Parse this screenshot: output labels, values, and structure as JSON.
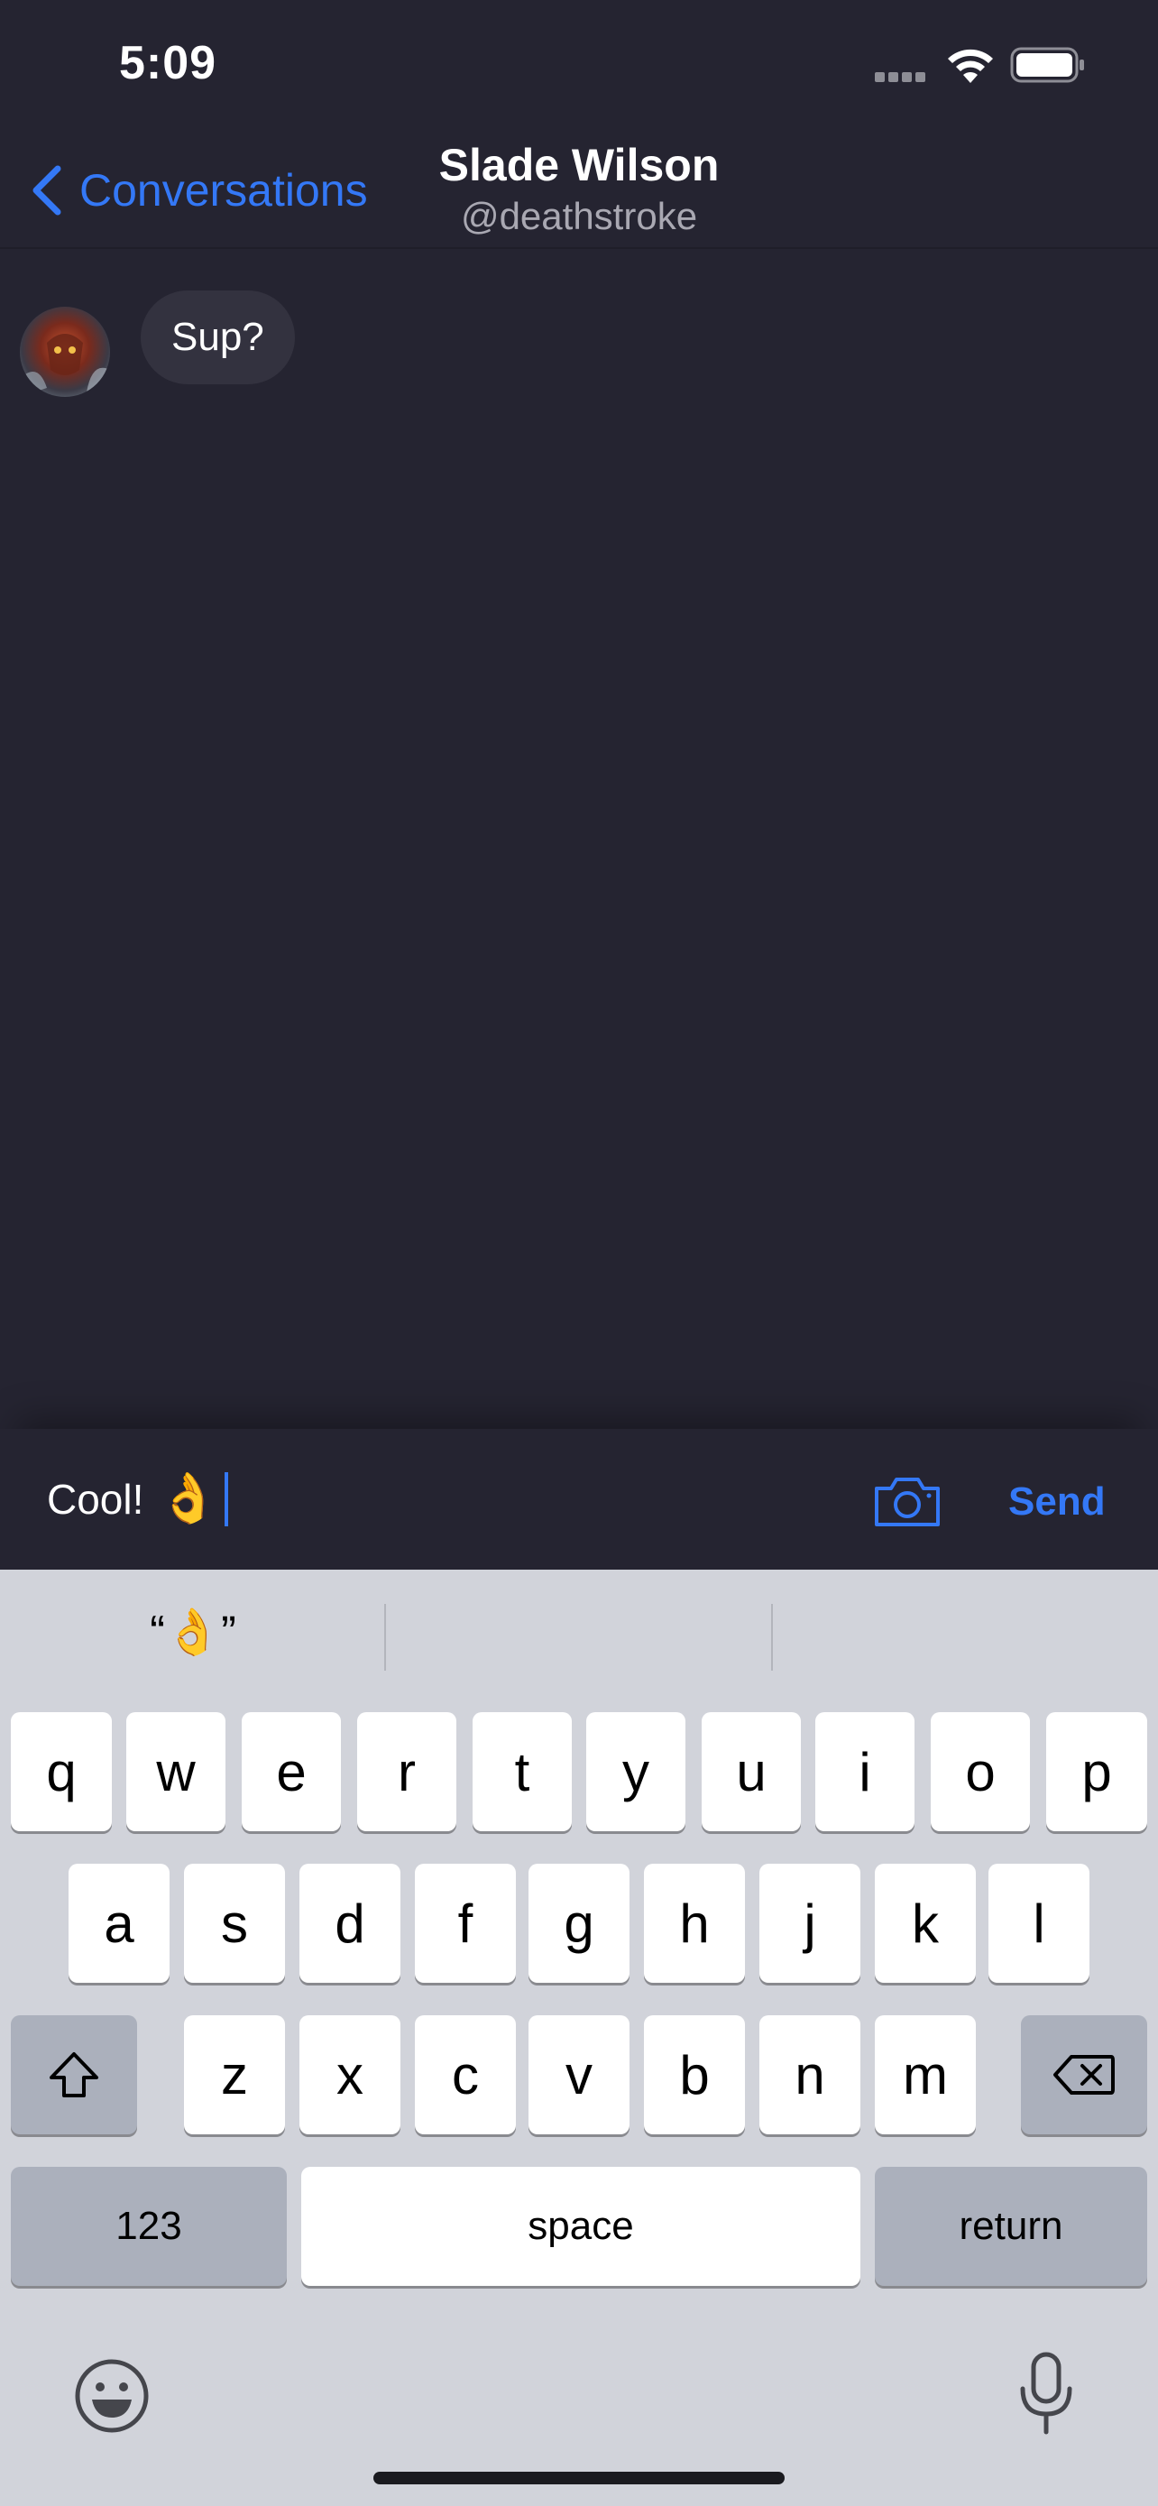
{
  "status_bar": {
    "time": "5:09"
  },
  "nav": {
    "back_label": "Conversations",
    "title": "Slade Wilson",
    "subtitle": "@deathstroke"
  },
  "messages": [
    {
      "sender": "Slade Wilson",
      "text": "Sup?"
    }
  ],
  "composer": {
    "text": "Cool!",
    "emoji": "👌",
    "send_label": "Send"
  },
  "keyboard": {
    "suggestions": [
      "“👌”",
      "",
      ""
    ],
    "row1": [
      "q",
      "w",
      "e",
      "r",
      "t",
      "y",
      "u",
      "i",
      "o",
      "p"
    ],
    "row2": [
      "a",
      "s",
      "d",
      "f",
      "g",
      "h",
      "j",
      "k",
      "l"
    ],
    "row3": [
      "z",
      "x",
      "c",
      "v",
      "b",
      "n",
      "m"
    ],
    "numbers_label": "123",
    "space_label": "space",
    "return_label": "return"
  },
  "colors": {
    "accent": "#3478f6",
    "background": "#252431",
    "bubble": "#33323f",
    "keyboard": "#d1d3da"
  }
}
